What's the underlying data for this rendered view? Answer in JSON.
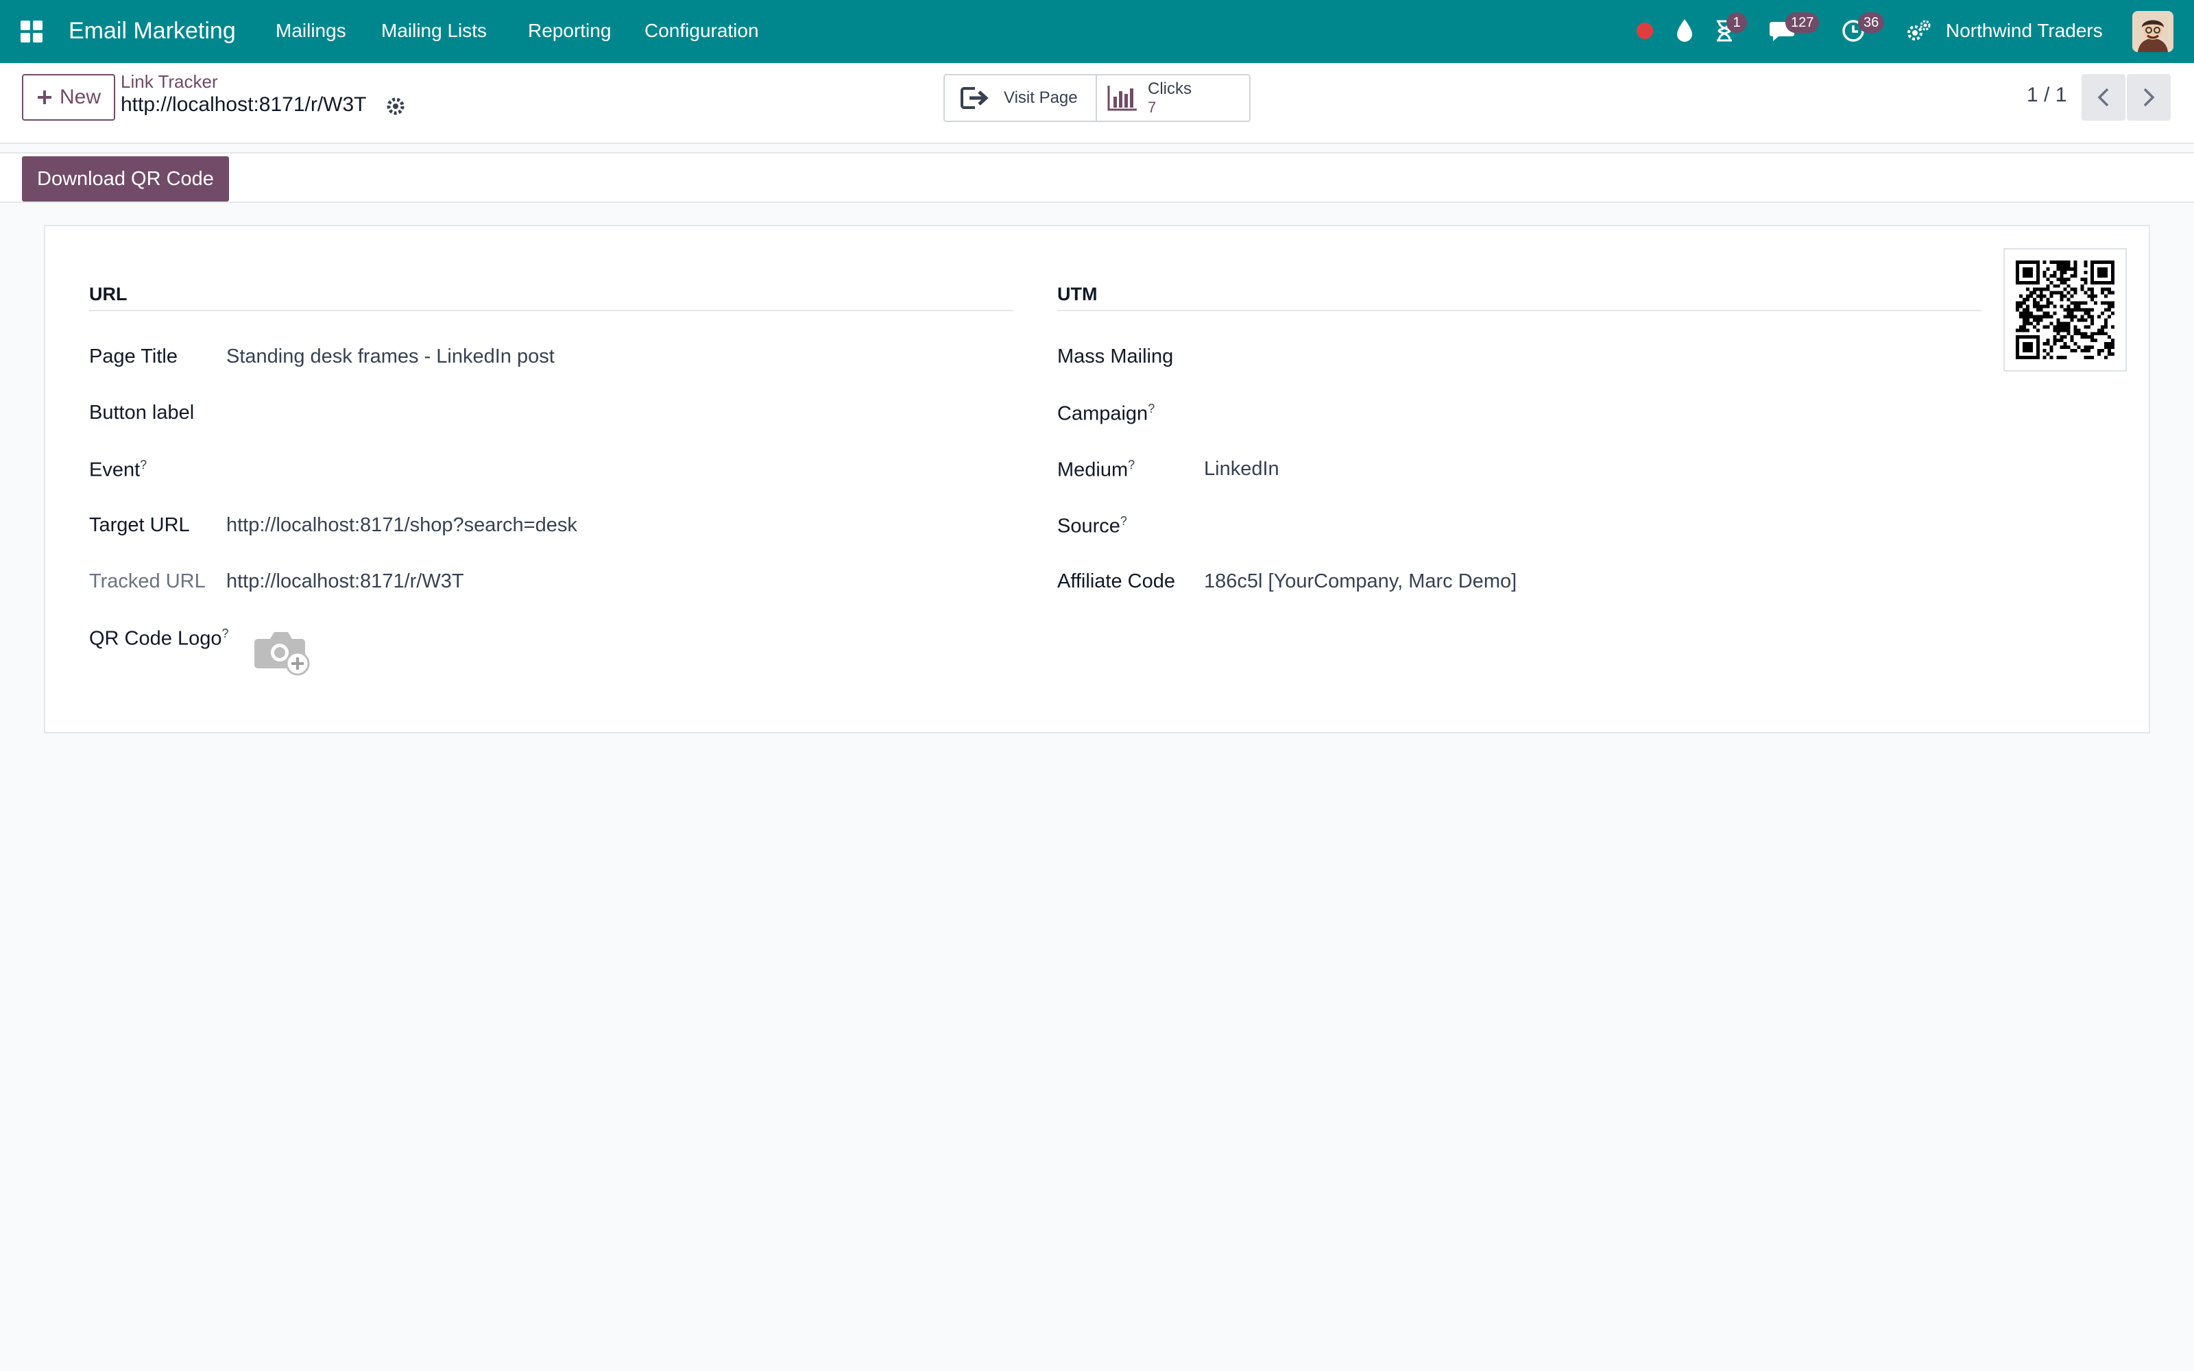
{
  "navbar": {
    "brand": "Email Marketing",
    "menus": [
      "Mailings",
      "Mailing Lists",
      "Reporting",
      "Configuration"
    ],
    "badges": {
      "activity": "1",
      "messages": "127",
      "clock": "36"
    },
    "company": "Northwind Traders"
  },
  "control_panel": {
    "new_label": "New",
    "breadcrumb": "Link Tracker",
    "record_title": "http://localhost:8171/r/W3T",
    "visit_page_label": "Visit Page",
    "clicks_label": "Clicks",
    "clicks_value": "7",
    "pager": "1 / 1"
  },
  "statusbar": {
    "download_qr_label": "Download QR Code"
  },
  "form": {
    "url_group": {
      "title": "URL",
      "fields": [
        {
          "label": "Page Title",
          "value": "Standing desk frames - LinkedIn post",
          "help": ""
        },
        {
          "label": "Button label",
          "value": "",
          "help": ""
        },
        {
          "label": "Event",
          "value": "",
          "help": "?"
        },
        {
          "label": "Target URL",
          "value": "http://localhost:8171/shop?search=desk",
          "help": ""
        },
        {
          "label": "Tracked URL",
          "value": "http://localhost:8171/r/W3T",
          "help": ""
        },
        {
          "label": "QR Code Logo",
          "value": "",
          "help": "?"
        }
      ]
    },
    "utm_group": {
      "title": "UTM",
      "fields": [
        {
          "label": "Mass Mailing",
          "value": "",
          "help": ""
        },
        {
          "label": "Campaign",
          "value": "",
          "help": "?"
        },
        {
          "label": "Medium",
          "value": "LinkedIn",
          "help": "?"
        },
        {
          "label": "Source",
          "value": "",
          "help": "?"
        },
        {
          "label": "Affiliate Code",
          "value": "186c5l [YourCompany, Marc Demo]",
          "help": ""
        }
      ]
    }
  },
  "colors": {
    "navbar": "#00878e",
    "primary": "#714b67",
    "badge": "#714b67",
    "record_dot": "#e03e3e"
  },
  "icons": [
    "apps-grid-icon",
    "record-dot-icon",
    "droplet-icon",
    "hourglass-icon",
    "chat-icon",
    "clock-icon",
    "settings-gears-icon",
    "gear-icon",
    "sign-in-icon",
    "bar-chart-icon",
    "chevron-left-icon",
    "chevron-right-icon",
    "camera-plus-icon",
    "qr-code-icon"
  ]
}
